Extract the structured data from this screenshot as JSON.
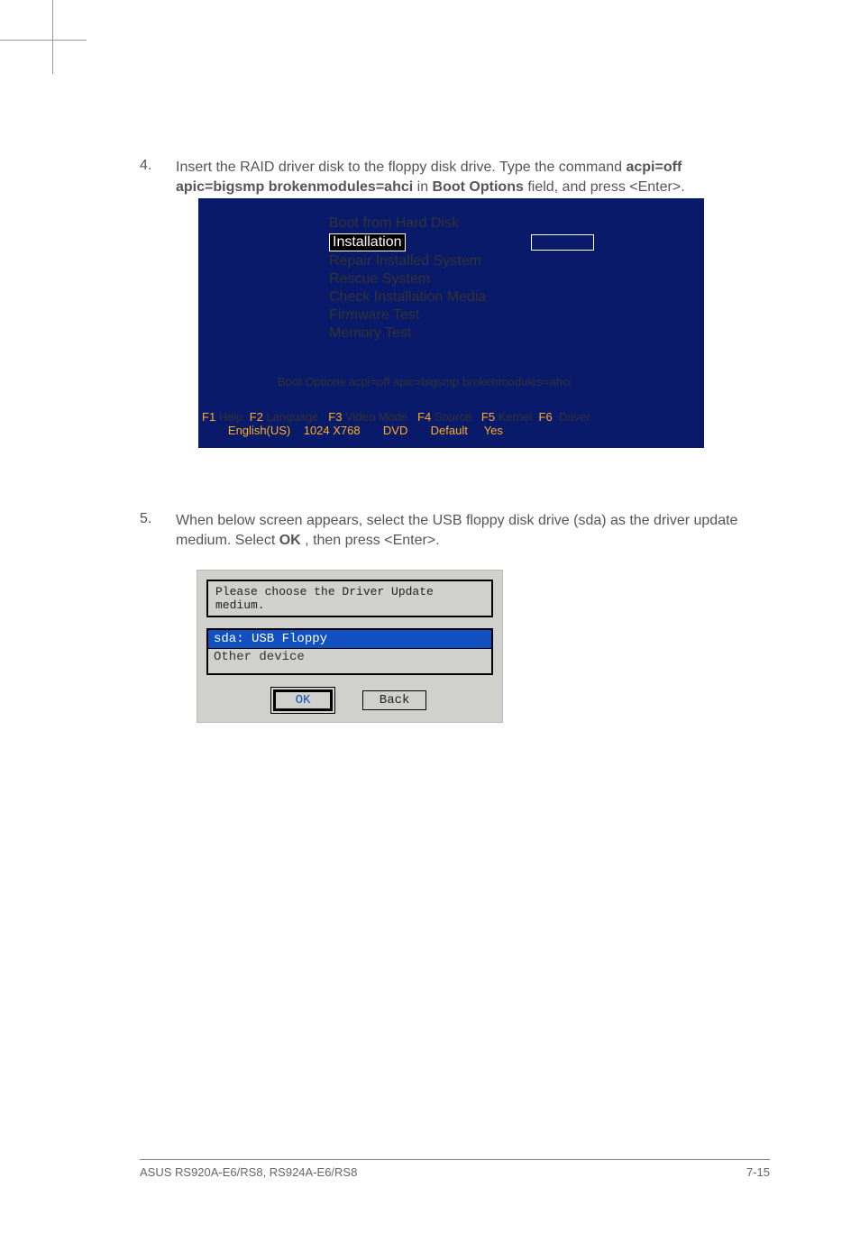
{
  "step4": {
    "num": "4.",
    "text_pre": "Insert the RAID driver disk to the floppy disk drive. Type the command ",
    "cmd": "acpi=off apic=bigsmp brokenmodules=ahci",
    "text_mid": " in ",
    "field": "Boot Options",
    "text_post": " field, and press <Enter>."
  },
  "boot": {
    "items": [
      "Boot from Hard Disk",
      "Installation",
      "Repair Installed System",
      "Rescue System",
      "Check Installation Media",
      "Firmware Test",
      "Memory Test"
    ],
    "selected_index": 1,
    "boot_options_label": "Boot Options",
    "boot_options_value": "acpi=off apic=bigsmp brokenmodules=ahci",
    "fn": {
      "f1": {
        "k": "F1",
        "label": "Help"
      },
      "f2": {
        "k": "F2",
        "label": "Language",
        "sub": "English(US)"
      },
      "f3": {
        "k": "F3",
        "label": "Video Mode",
        "sub": "1024 X768"
      },
      "f4": {
        "k": "F4",
        "label": "Source",
        "sub": "DVD"
      },
      "f5": {
        "k": "F5",
        "label": "Kernel",
        "sub": "Default"
      },
      "f6": {
        "k": "F6",
        "label": "Driver",
        "sub": "Yes"
      }
    }
  },
  "step5": {
    "num": "5.",
    "text_pre": "When below screen appears, select the USB floppy disk drive (sda) as the driver update medium. Select ",
    "ok": "OK",
    "text_post": ", then press <Enter>."
  },
  "dialog": {
    "title": "Please choose the Driver Update medium.",
    "options": [
      "sda: USB Floppy",
      "Other device"
    ],
    "selected_index": 0,
    "ok": "OK",
    "back": "Back"
  },
  "footer": {
    "left": "ASUS RS920A-E6/RS8, RS924A-E6/RS8",
    "right": "7-15"
  }
}
